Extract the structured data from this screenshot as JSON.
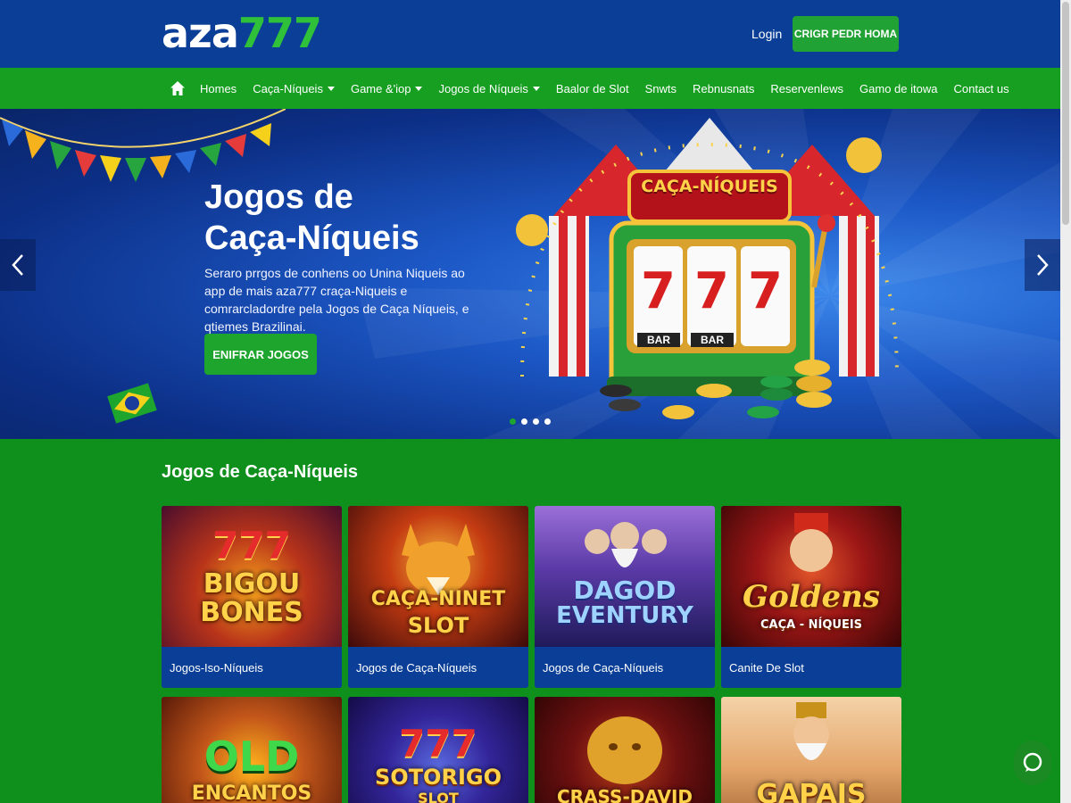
{
  "header": {
    "logo_part1": "aza",
    "logo_part2": "777",
    "login_label": "Login",
    "signup_label": "CRIGR PEDR HOMA"
  },
  "nav": {
    "items": [
      {
        "label": "Homes",
        "dropdown": false
      },
      {
        "label": "Caça-Níqueis",
        "dropdown": true
      },
      {
        "label": "Game &'iop",
        "dropdown": true
      },
      {
        "label": "Jogos de Níqueis",
        "dropdown": true
      },
      {
        "label": "Baalor de Slot",
        "dropdown": false
      },
      {
        "label": "Snwts",
        "dropdown": false
      },
      {
        "label": "Rebnusnats",
        "dropdown": false
      },
      {
        "label": "Reservenlews",
        "dropdown": false
      },
      {
        "label": "Gamo de itowa",
        "dropdown": false
      },
      {
        "label": "Contact us",
        "dropdown": false
      }
    ]
  },
  "hero": {
    "title_line1": "Jogos de",
    "title_line2": "Caça-Níqueis",
    "description": "Seraro prrgos de conhens oo Unina Niqueis ao app de mais aza777 craça-Niqueis e comrarcladordre pela Jogos de Caça Níqueis, e qtiemes Brazilinai.",
    "button_label": "ENIFRAR JOGOS",
    "sign_text": "CAÇA-NÍQUEIS",
    "reel_symbol": "7",
    "bar_label": "BAR",
    "slide_count": 4,
    "active_slide": 1
  },
  "section": {
    "title": "Jogos de Caça-Níqueis"
  },
  "games": [
    {
      "art_line1": "777",
      "art_line2": "BIGOU",
      "art_line3": "BONES",
      "caption": "Jogos-Iso-Níqueis"
    },
    {
      "art_line1": "",
      "art_line2": "CAÇA-NINET",
      "art_line3": "SLOT",
      "caption": "Jogos de Caça-Níqueis"
    },
    {
      "art_line1": "",
      "art_line2": "DAGOD",
      "art_line3": "EVENTURY",
      "caption": "Jogos de Caça-Níqueis"
    },
    {
      "art_line1": "",
      "art_line2": "Goldens",
      "art_line3": "CAÇA - NÍQUEIS",
      "caption": "Canite De Slot"
    },
    {
      "art_line1": "",
      "art_line2": "OLD",
      "art_line3": "ENCANTOS",
      "caption": ""
    },
    {
      "art_line1": "777",
      "art_line2": "SOTORIGO",
      "art_line3": "SLOT",
      "caption": ""
    },
    {
      "art_line1": "",
      "art_line2": "",
      "art_line3": "CRASS-DAVID",
      "caption": ""
    },
    {
      "art_line1": "",
      "art_line2": "",
      "art_line3": "GAPAIS",
      "caption": ""
    }
  ],
  "colors": {
    "header_blue": "#0b3f97",
    "nav_green": "#169f20",
    "page_green": "#0f8f1c",
    "accent_green": "#1ea52e",
    "logo_green": "#2fc13a"
  },
  "icons": {
    "home": "home-icon",
    "prev": "chevron-left-icon",
    "next": "chevron-right-icon",
    "chat": "chat-bubble-icon"
  }
}
